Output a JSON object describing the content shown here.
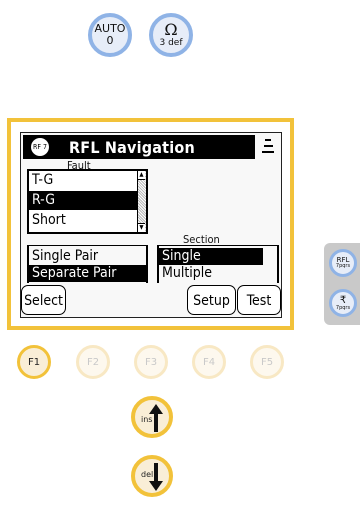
{
  "top_keys": {
    "auto": {
      "label": "AUTO",
      "sub": "0"
    },
    "ohm": {
      "label": "Ω",
      "sub": "3 def"
    }
  },
  "screen": {
    "logo_text": "RF 7",
    "title": "RFL Navigation",
    "fault": {
      "label": "Fault",
      "items": [
        "T-G",
        "R-G",
        "Short"
      ],
      "selected": "R-G"
    },
    "pair": {
      "options": [
        "Single Pair",
        "Separate Pair"
      ],
      "selected": "Separate Pair"
    },
    "section": {
      "label": "Section",
      "options": [
        "Single",
        "Multiple"
      ],
      "selected": "Single"
    },
    "softkeys": {
      "select": "Select",
      "setup": "Setup",
      "test": "Test"
    }
  },
  "function_keys": [
    "F1",
    "F2",
    "F3",
    "F4",
    "F5"
  ],
  "function_keys_active": [
    "F1"
  ],
  "arrow_keys": {
    "ins": "ins",
    "del": "del"
  },
  "side_keys": {
    "rfl": {
      "label": "RFL",
      "sub": "7pqrs"
    },
    "seven": {
      "label": "₹",
      "sub": "7pqrs"
    }
  },
  "colors": {
    "panel_border": "#f2c23a",
    "key_ring_blue": "#8fb3e6",
    "key_ring_yellow": "#f2c23a"
  }
}
